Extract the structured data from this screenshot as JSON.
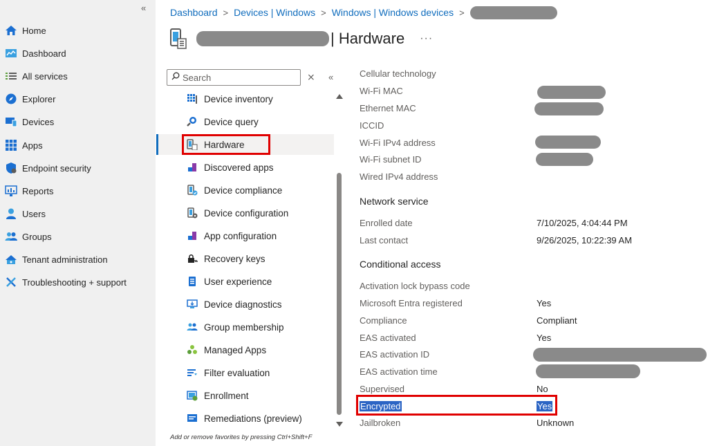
{
  "nav": {
    "collapse_glyph": "«",
    "items": [
      {
        "label": "Home",
        "icon": "home-icon"
      },
      {
        "label": "Dashboard",
        "icon": "dashboard-icon"
      },
      {
        "label": "All services",
        "icon": "list-icon"
      },
      {
        "label": "Explorer",
        "icon": "explorer-icon"
      },
      {
        "label": "Devices",
        "icon": "devices-icon"
      },
      {
        "label": "Apps",
        "icon": "apps-grid-icon"
      },
      {
        "label": "Endpoint security",
        "icon": "shield-icon"
      },
      {
        "label": "Reports",
        "icon": "reports-icon"
      },
      {
        "label": "Users",
        "icon": "user-icon"
      },
      {
        "label": "Groups",
        "icon": "groups-icon"
      },
      {
        "label": "Tenant administration",
        "icon": "tenant-admin-icon"
      },
      {
        "label": "Troubleshooting + support",
        "icon": "wrench-icon"
      }
    ]
  },
  "breadcrumb": {
    "items": [
      "Dashboard",
      "Devices | Windows",
      "Windows | Windows devices"
    ],
    "separator": ">"
  },
  "title": {
    "suffix": "| Hardware",
    "more": "···"
  },
  "menu": {
    "search_placeholder": "Search",
    "clear_glyph": "⨯",
    "collapse_glyph": "«",
    "items": [
      {
        "label": "Device inventory",
        "icon": "device-inventory-icon"
      },
      {
        "label": "Device query",
        "icon": "device-query-icon"
      },
      {
        "label": "Hardware",
        "icon": "hardware-icon",
        "selected": true
      },
      {
        "label": "Discovered apps",
        "icon": "discovered-apps-icon"
      },
      {
        "label": "Device compliance",
        "icon": "device-compliance-icon"
      },
      {
        "label": "Device configuration",
        "icon": "device-configuration-icon"
      },
      {
        "label": "App configuration",
        "icon": "app-configuration-icon"
      },
      {
        "label": "Recovery keys",
        "icon": "key-icon"
      },
      {
        "label": "User experience",
        "icon": "user-experience-icon"
      },
      {
        "label": "Device diagnostics",
        "icon": "device-diagnostics-icon"
      },
      {
        "label": "Group membership",
        "icon": "group-membership-icon"
      },
      {
        "label": "Managed Apps",
        "icon": "managed-apps-icon"
      },
      {
        "label": "Filter evaluation",
        "icon": "filter-icon"
      },
      {
        "label": "Enrollment",
        "icon": "enrollment-icon"
      },
      {
        "label": "Remediations (preview)",
        "icon": "remediations-icon"
      }
    ],
    "favorites_hint": "Add or remove favorites by pressing Ctrl+Shift+F"
  },
  "properties": {
    "cellular_technology": {
      "label": "Cellular technology"
    },
    "wifi_mac": {
      "label": "Wi-Fi MAC"
    },
    "ethernet_mac": {
      "label": "Ethernet MAC"
    },
    "iccid": {
      "label": "ICCID"
    },
    "wifi_ipv4": {
      "label": "Wi-Fi IPv4 address"
    },
    "wifi_subnet": {
      "label": "Wi-Fi subnet ID"
    },
    "wired_ipv4": {
      "label": "Wired IPv4 address"
    },
    "network_service": {
      "heading": "Network service"
    },
    "enrolled_date": {
      "label": "Enrolled date",
      "value": "7/10/2025, 4:04:44 PM"
    },
    "last_contact": {
      "label": "Last contact",
      "value": "9/26/2025, 10:22:39 AM"
    },
    "conditional_access": {
      "heading": "Conditional access"
    },
    "activation_lock": {
      "label": "Activation lock bypass code"
    },
    "entra_registered": {
      "label": "Microsoft Entra registered",
      "value": "Yes"
    },
    "compliance": {
      "label": "Compliance",
      "value": "Compliant"
    },
    "eas_activated": {
      "label": "EAS activated",
      "value": "Yes"
    },
    "eas_activation_id": {
      "label": "EAS activation ID"
    },
    "eas_activation_time": {
      "label": "EAS activation time"
    },
    "supervised": {
      "label": "Supervised",
      "value": "No"
    },
    "encrypted": {
      "label": "Encrypted",
      "value": "Yes"
    },
    "jailbroken": {
      "label": "Jailbroken",
      "value": "Unknown"
    }
  },
  "colors": {
    "accent": "#0f6cbd",
    "highlight_border": "#e00000",
    "selection": "#2b64c4",
    "redaction": "#8a8a8a"
  }
}
